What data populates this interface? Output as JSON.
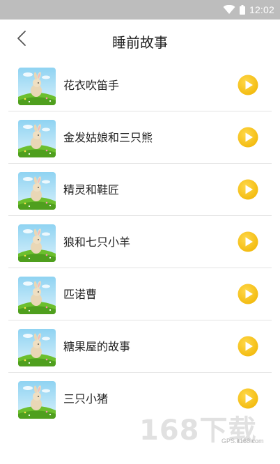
{
  "status_bar": {
    "time": "12:02"
  },
  "header": {
    "title": "睡前故事"
  },
  "stories": [
    {
      "title": "花衣吹笛手"
    },
    {
      "title": "金发姑娘和三只熊"
    },
    {
      "title": "精灵和鞋匠"
    },
    {
      "title": "狼和七只小羊"
    },
    {
      "title": "匹诺曹"
    },
    {
      "title": "糖果屋的故事"
    },
    {
      "title": "三只小猪"
    }
  ],
  "watermark": {
    "logo": "168下载",
    "url": "GPS.it168.com"
  },
  "colors": {
    "play": "#f5c518",
    "status_bar": "#bdbdbd",
    "divider": "#e3e3e3"
  }
}
